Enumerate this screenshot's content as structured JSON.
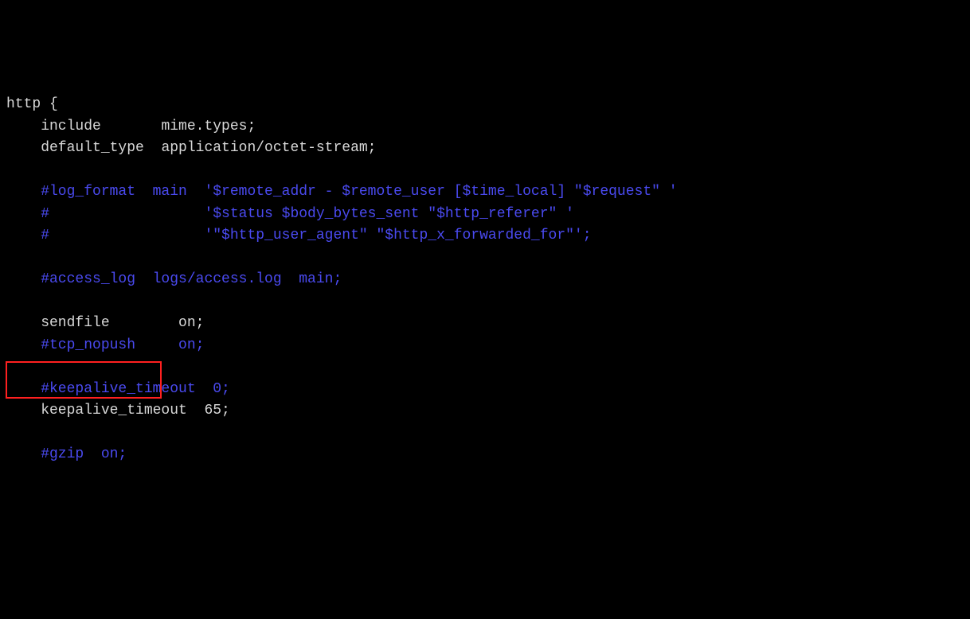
{
  "lines": {
    "l1a": "http ",
    "l1b": "{",
    "l2a": "    include       ",
    "l2b": "mime.types;",
    "l3a": "    default_type  ",
    "l3b": "application/octet-stream;",
    "l4": "",
    "l5": "    #log_format  main  '$remote_addr - $remote_user [$time_local] \"$request\" '",
    "l6": "    #                  '$status $body_bytes_sent \"$http_referer\" '",
    "l7": "    #                  '\"$http_user_agent\" \"$http_x_forwarded_for\"';",
    "l8": "",
    "l9": "    #access_log  logs/access.log  main;",
    "l10": "",
    "l11a": "    sendfile        ",
    "l11b": "on;",
    "l12": "    #tcp_nopush     on;",
    "l13": "",
    "l14": "    #keepalive_timeout  0;",
    "l15a": "    keepalive_timeout  ",
    "l15b": "65;",
    "l16": "",
    "l17": "    #gzip  on;"
  }
}
